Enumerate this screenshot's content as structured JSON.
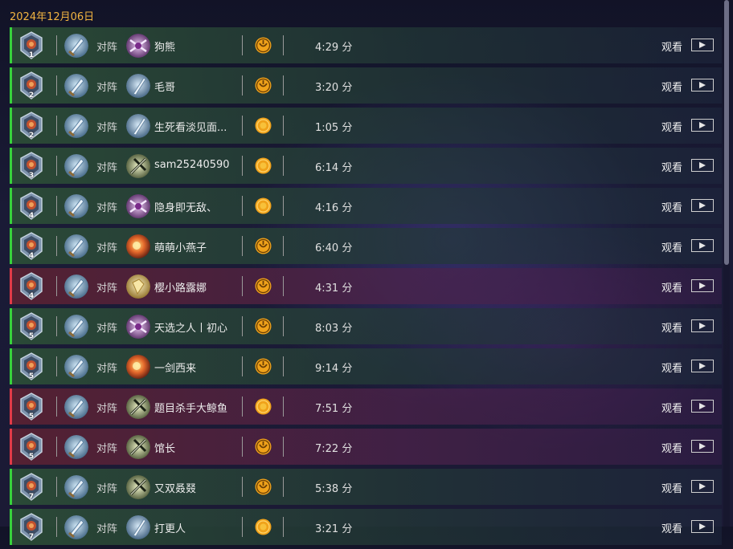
{
  "date_header": "2024年12月06日",
  "vs_label": "对阵",
  "watch_label": "观看",
  "colors": {
    "win": "#37d23c",
    "loss": "#e13a48",
    "accent": "#f2b441"
  },
  "matches": [
    {
      "result": "win",
      "rank": "1",
      "opponent": "狗熊",
      "opponent_hero": "demonhunter",
      "mode": "wild",
      "duration": "4:29 分"
    },
    {
      "result": "win",
      "rank": "2",
      "opponent": "毛哥",
      "opponent_hero": "warrior",
      "mode": "wild",
      "duration": "3:20 分"
    },
    {
      "result": "win",
      "rank": "2",
      "opponent": "生死看淡见面...",
      "opponent_hero": "warrior",
      "mode": "standard",
      "duration": "1:05 分"
    },
    {
      "result": "win",
      "rank": "3",
      "opponent": "sam25240590",
      "opponent_hero": "deathknight",
      "mode": "standard",
      "duration": "6:14 分"
    },
    {
      "result": "win",
      "rank": "4",
      "opponent": "隐身即无敌、",
      "opponent_hero": "demonhunter",
      "mode": "standard",
      "duration": "4:16 分"
    },
    {
      "result": "win",
      "rank": "4",
      "opponent": "萌萌小燕子",
      "opponent_hero": "mage",
      "mode": "wild",
      "duration": "6:40 分"
    },
    {
      "result": "loss",
      "rank": "4",
      "opponent": "樱小路露娜",
      "opponent_hero": "paladin",
      "mode": "wild",
      "duration": "4:31 分"
    },
    {
      "result": "win",
      "rank": "5",
      "opponent": "天选之人丨初心",
      "opponent_hero": "demonhunter",
      "mode": "wild",
      "duration": "8:03 分"
    },
    {
      "result": "win",
      "rank": "5",
      "opponent": "一剑西来",
      "opponent_hero": "mage",
      "mode": "wild",
      "duration": "9:14 分"
    },
    {
      "result": "loss",
      "rank": "5",
      "opponent": "题目杀手大鲸鱼",
      "opponent_hero": "deathknight",
      "mode": "standard",
      "duration": "7:51 分"
    },
    {
      "result": "loss",
      "rank": "5",
      "opponent": "馆长",
      "opponent_hero": "deathknight",
      "mode": "wild",
      "duration": "7:22 分"
    },
    {
      "result": "win",
      "rank": "7",
      "opponent": "又双叒叕",
      "opponent_hero": "deathknight",
      "mode": "wild",
      "duration": "5:38 分"
    },
    {
      "result": "win",
      "rank": "7",
      "opponent": "打更人",
      "opponent_hero": "warrior",
      "mode": "standard",
      "duration": "3:21 分"
    }
  ]
}
